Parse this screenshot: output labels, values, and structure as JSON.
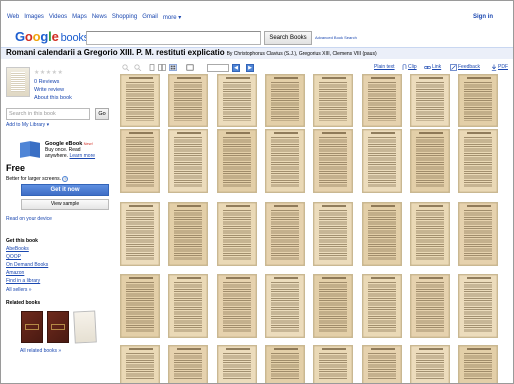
{
  "topnav": [
    "Web",
    "Images",
    "Videos",
    "Maps",
    "News",
    "Shopping",
    "Gmail",
    "more ▾"
  ],
  "signin": "Sign in",
  "logo": {
    "g1": "G",
    "o1": "o",
    "o2": "o",
    "g2": "g",
    "l": "l",
    "e": "e",
    "books": "books"
  },
  "search": {
    "button": "Search Books",
    "advanced": "Advanced Book Search",
    "value": ""
  },
  "book": {
    "title": "Romani calendarii a Gregorio XIII. P. M. restituti explicatio",
    "byline": "By Christophorus Clavius (S.J.), Gregorius XIII, Clemens VIII (paus)",
    "stars": "★★★★★",
    "reviews": "0 Reviews",
    "write_review": "Write review",
    "about": "About this book"
  },
  "sidebar": {
    "search_placeholder": "Search in this book",
    "go": "Go",
    "add_library": "Add to My Library ▾",
    "ebook_title": "Google eBook",
    "ebook_new": "New!",
    "ebook_line2": "Buy once. Read",
    "ebook_line3": "anywhere.",
    "learn_more": "Learn more",
    "free": "Free",
    "better": "Better for larger screens.",
    "help_icon": "?",
    "get_it": "Get it now",
    "view_sample": "View sample",
    "read_device": "Read on your device",
    "get_book": "Get this book",
    "buy_links": [
      "AbeBooks",
      "QOOP",
      "On Demand Books",
      "Amazon",
      "Find in a library",
      "All sellers »"
    ],
    "related": "Related books",
    "all_related": "All related books »"
  },
  "toolbar": {
    "plain_text": "Plain text",
    "clip": "Clip",
    "link": "Link",
    "feedback": "Feedback",
    "pdf": "PDF",
    "prev": "◀",
    "next": "▶",
    "page_value": ""
  },
  "colors": {
    "link": "#1a47b0",
    "titlebar": "#ebeff9",
    "page": "#e8d8b8",
    "button": "#4f85d6"
  },
  "icons": [
    "zoom-out-icon",
    "zoom-in-icon",
    "one-page-icon",
    "two-page-icon",
    "thumbnail-view-icon",
    "fullscreen-icon",
    "clip-icon",
    "link-icon",
    "feedback-icon",
    "pdf-icon"
  ],
  "thumbnail_rows": 5,
  "thumbnail_cols": 8
}
